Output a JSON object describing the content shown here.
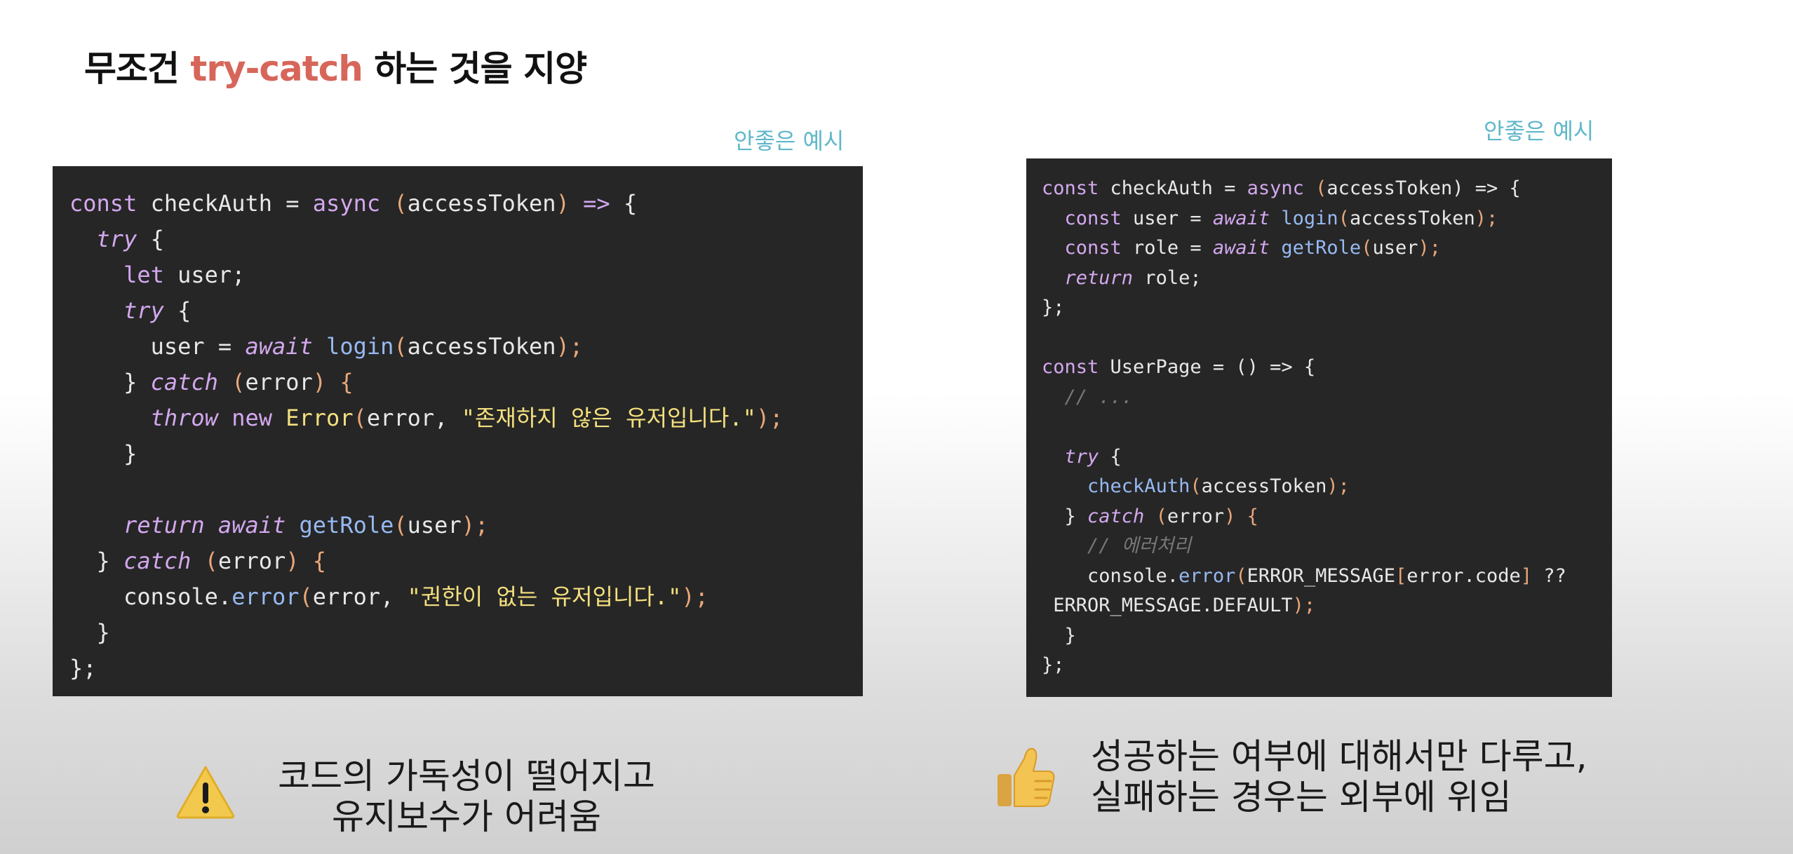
{
  "title": {
    "prefix": "무조건 ",
    "highlight": "try-catch",
    "suffix": " 하는 것을 지양"
  },
  "left_example": {
    "caption": "안좋은 예시",
    "code": {
      "line1": {
        "a": "const",
        "b": " checkAuth = ",
        "c": "async",
        "d": " (",
        "e": "accessToken",
        "f": ") ",
        "g": "=>",
        "h": " {"
      },
      "line2": {
        "a": "  ",
        "b": "try",
        "c": " {"
      },
      "line3": {
        "a": "    ",
        "b": "let",
        "c": " user;"
      },
      "line4": {
        "a": "    ",
        "b": "try",
        "c": " {"
      },
      "line5": {
        "a": "      user = ",
        "b": "await",
        "c": " ",
        "d": "login",
        "e": "(",
        "f": "accessToken",
        "g": ");"
      },
      "line6": {
        "a": "    } ",
        "b": "catch",
        "c": " (",
        "d": "error",
        "e": ") {"
      },
      "line7": {
        "a": "      ",
        "b": "throw",
        "c": " ",
        "d": "new",
        "e": " ",
        "f": "Error",
        "g": "(",
        "h": "error, ",
        "i": "\"존재하지 않은 유저입니다.\"",
        "j": ");"
      },
      "line8": "    }",
      "line9": "",
      "line10": {
        "a": "    ",
        "b": "return",
        "c": " ",
        "d": "await",
        "e": " ",
        "f": "getRole",
        "g": "(",
        "h": "user",
        "i": ");"
      },
      "line11": {
        "a": "  } ",
        "b": "catch",
        "c": " (",
        "d": "error",
        "e": ") {"
      },
      "line12": {
        "a": "    console.",
        "b": "error",
        "c": "(",
        "d": "error, ",
        "e": "\"권한이 없는 유저입니다.\"",
        "f": ");"
      },
      "line13": "  }",
      "line14": "};"
    },
    "note": {
      "line1": "코드의 가독성이 떨어지고",
      "line2": "유지보수가 어려움"
    }
  },
  "right_example": {
    "caption": "안좋은 예시",
    "code": {
      "l1": {
        "a": "const",
        "b": " checkAuth = ",
        "c": "async",
        "d": " (",
        "e": "accessToken",
        "f": ") => {"
      },
      "l2": {
        "a": "  ",
        "b": "const",
        "c": " user = ",
        "d": "await",
        "e": " ",
        "f": "login",
        "g": "(",
        "h": "accessToken",
        "i": ");"
      },
      "l3": {
        "a": "  ",
        "b": "const",
        "c": " role = ",
        "d": "await",
        "e": " ",
        "f": "getRole",
        "g": "(",
        "h": "user",
        "i": ");"
      },
      "l4": {
        "a": "  ",
        "b": "return",
        "c": " role;"
      },
      "l5": "};",
      "l6": "",
      "l7": {
        "a": "const",
        "b": " UserPage = () => {"
      },
      "l8": {
        "a": "  ",
        "b": "// ..."
      },
      "l9": "",
      "l10": {
        "a": "  ",
        "b": "try",
        "c": " {"
      },
      "l11": {
        "a": "    ",
        "b": "checkAuth",
        "c": "(",
        "d": "accessToken",
        "e": ");"
      },
      "l12": {
        "a": "  } ",
        "b": "catch",
        "c": " (",
        "d": "error",
        "e": ") {"
      },
      "l13": {
        "a": "    ",
        "b": "// 에러처리"
      },
      "l14": {
        "a": "    console.",
        "b": "error",
        "c": "(",
        "d": "ERROR_MESSAGE",
        "e": "[",
        "f": "error.code",
        "g": "]",
        "h": " ??"
      },
      "l15": {
        "a": " ERROR_MESSAGE.DEFAULT",
        "b": ");"
      },
      "l16": "  }",
      "l17": "};"
    },
    "note": {
      "line1": "성공하는 여부에 대해서만 다루고,",
      "line2": "실패하는 경우는 외부에 위임"
    }
  },
  "icons": {
    "warning": "warning-icon",
    "thumbs_up": "thumbs-up-icon"
  },
  "colors": {
    "title_accent": "#d7665a",
    "caption": "#5fb8c9",
    "code_background": "#262626",
    "keyword": "#d3a8ef",
    "function": "#97b9f2",
    "string": "#f4e07e",
    "paren": "#e9a77a"
  }
}
